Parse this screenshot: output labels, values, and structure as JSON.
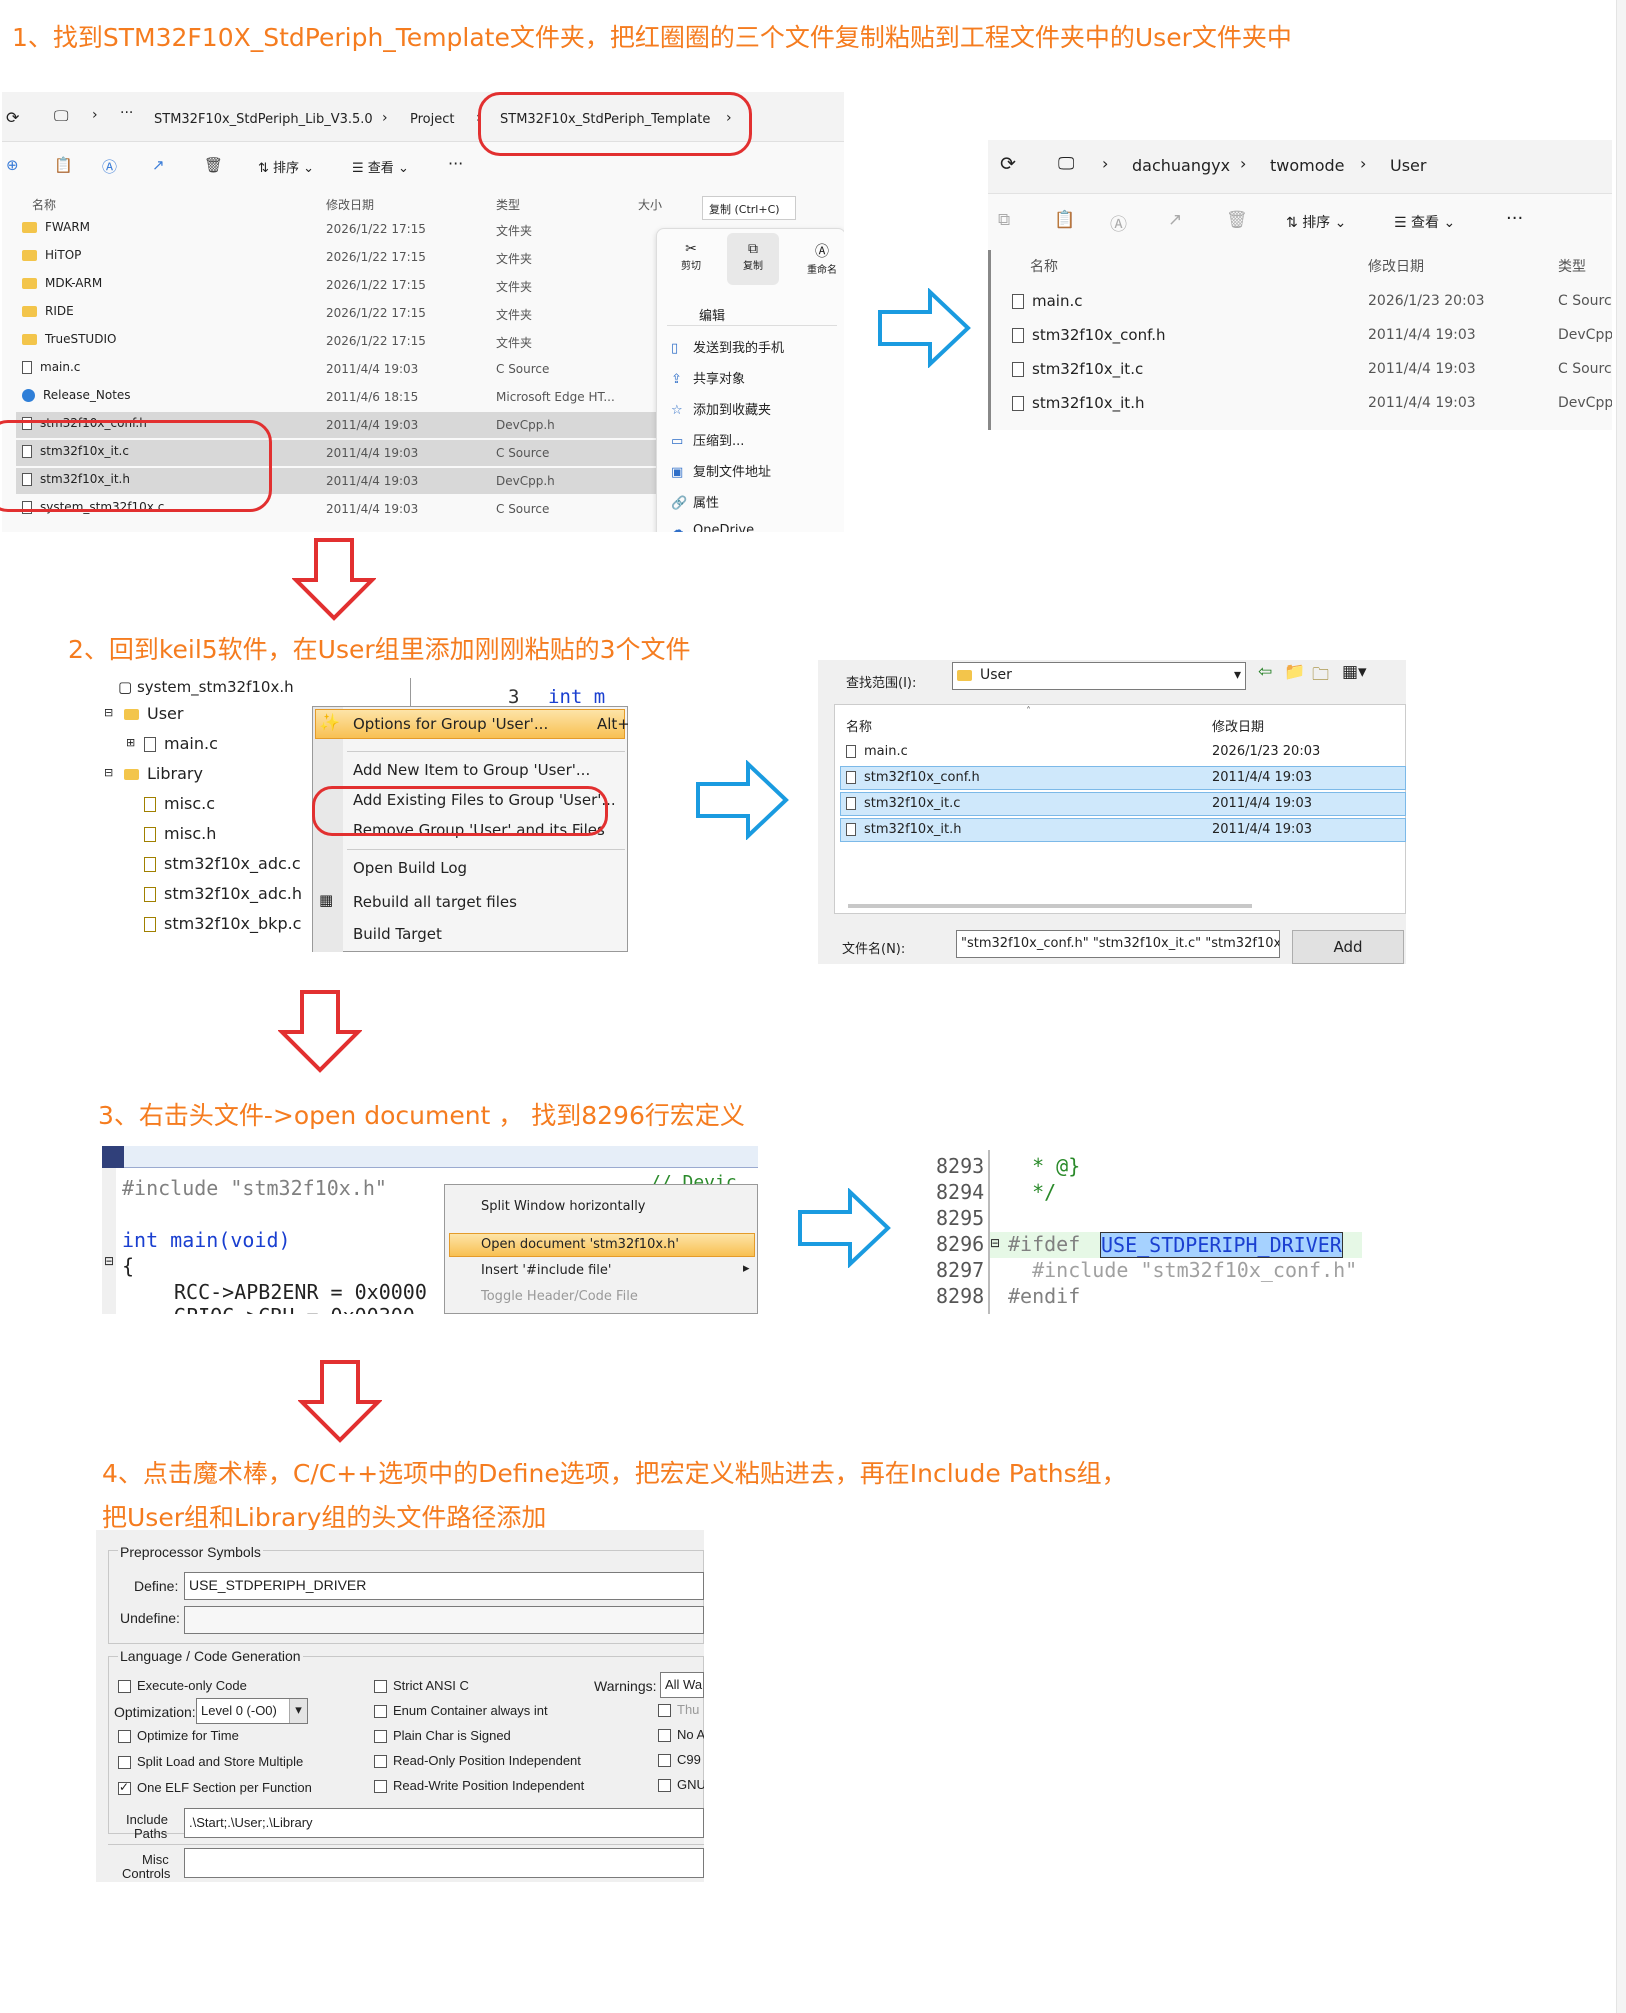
{
  "steps": {
    "s1": "1、找到STM32F10X_StdPeriph_Template文件夹，把红圈圈的三个文件复制粘贴到工程文件夹中的User文件夹中",
    "s2": "2、回到keil5软件，在User组里添加刚刚粘贴的3个文件",
    "s3": "3、右击头文件->open document ， 找到8296行宏定义",
    "s4a": "4、点击魔术棒，C/C++选项中的Define选项，把宏定义粘贴进去，再在Include Paths组，",
    "s4b": "把User组和Library组的头文件路径添加"
  },
  "explorer1": {
    "crumbs": [
      "STM32F10x_StdPeriph_Lib_V3.5.0",
      "Project",
      "STM32F10x_StdPeriph_Template"
    ],
    "sort": "排序",
    "view": "查看",
    "more": "···",
    "cols": [
      "名称",
      "修改日期",
      "类型",
      "大小"
    ],
    "rows": [
      {
        "name": "FWARM",
        "date": "2026/1/22 17:15",
        "type": "文件夹",
        "kind": "folder"
      },
      {
        "name": "HiTOP",
        "date": "2026/1/22 17:15",
        "type": "文件夹",
        "kind": "folder"
      },
      {
        "name": "MDK-ARM",
        "date": "2026/1/22 17:15",
        "type": "文件夹",
        "kind": "folder"
      },
      {
        "name": "RIDE",
        "date": "2026/1/22 17:15",
        "type": "文件夹",
        "kind": "folder"
      },
      {
        "name": "TrueSTUDIO",
        "date": "2026/1/22 17:15",
        "type": "文件夹",
        "kind": "folder"
      },
      {
        "name": "main.c",
        "date": "2011/4/4 19:03",
        "type": "C Source",
        "kind": "file"
      },
      {
        "name": "Release_Notes",
        "date": "2011/4/6 18:15",
        "type": "Microsoft Edge HT...",
        "kind": "edge"
      },
      {
        "name": "stm32f10x_conf.h",
        "date": "2011/4/4 19:03",
        "type": "DevCpp.h",
        "kind": "file"
      },
      {
        "name": "stm32f10x_it.c",
        "date": "2011/4/4 19:03",
        "type": "C Source",
        "kind": "file"
      },
      {
        "name": "stm32f10x_it.h",
        "date": "2011/4/4 19:03",
        "type": "DevCpp.h",
        "kind": "file"
      },
      {
        "name": "system_stm32f10x.c",
        "date": "2011/4/4 19:03",
        "type": "C Source",
        "kind": "file"
      }
    ],
    "tooltip": "复制 (Ctrl+C)",
    "ctx_icons": [
      "剪切",
      "复制",
      "重命名"
    ],
    "ctx": [
      "编辑",
      "发送到我的手机",
      "共享对象",
      "添加到收藏夹",
      "压缩到...",
      "复制文件地址",
      "属性",
      "OneDrive"
    ]
  },
  "explorer2": {
    "crumbs": [
      "dachuangyx",
      "twomode",
      "User"
    ],
    "sort": "排序",
    "view": "查看",
    "more": "···",
    "cols": [
      "名称",
      "修改日期",
      "类型"
    ],
    "rows": [
      {
        "name": "main.c",
        "date": "2026/1/23 20:03",
        "type": "C Sourc"
      },
      {
        "name": "stm32f10x_conf.h",
        "date": "2011/4/4 19:03",
        "type": "DevCpp"
      },
      {
        "name": "stm32f10x_it.c",
        "date": "2011/4/4 19:03",
        "type": "C Sourc"
      },
      {
        "name": "stm32f10x_it.h",
        "date": "2011/4/4 19:03",
        "type": "DevCpp"
      }
    ]
  },
  "keil_tree": {
    "top": "system_stm32f10x.h",
    "user": "User",
    "main": "main.c",
    "library": "Library",
    "libfiles": [
      "misc.c",
      "misc.h",
      "stm32f10x_adc.c",
      "stm32f10x_adc.h",
      "stm32f10x_bkp.c"
    ],
    "code_line": "3",
    "code_text": "int m",
    "menu": [
      {
        "label": "Options for Group 'User'...",
        "shortcut": "Alt+"
      },
      {
        "label": "Add New  Item to Group 'User'..."
      },
      {
        "label": "Add Existing Files to Group 'User'..."
      },
      {
        "label": "Remove Group 'User' and its Files"
      },
      {
        "label": "Open Build Log"
      },
      {
        "label": "Rebuild all target files"
      },
      {
        "label": "Build Target"
      }
    ]
  },
  "add_dialog": {
    "lookin_label": "查找范围(I):",
    "lookin_value": "User",
    "cols": [
      "名称",
      "修改日期"
    ],
    "rows": [
      {
        "name": "main.c",
        "date": "2026/1/23 20:03"
      },
      {
        "name": "stm32f10x_conf.h",
        "date": "2011/4/4 19:03"
      },
      {
        "name": "stm32f10x_it.c",
        "date": "2011/4/4 19:03"
      },
      {
        "name": "stm32f10x_it.h",
        "date": "2011/4/4 19:03"
      }
    ],
    "filename_label": "文件名(N):",
    "filename_value": "\"stm32f10x_conf.h\" \"stm32f10x_it.c\" \"stm32f10x_it.h\"",
    "add_btn": "Add"
  },
  "code1": {
    "include": "#include \"stm32f10x.h\"",
    "comment": "// Devic",
    "main": "int main(void)",
    "brace": "{",
    "rcc": "RCC->APB2ENR = 0x0000",
    "gpio": "GPIOC->CRH = 0x00300",
    "menu": [
      "Split Window horizontally",
      "Open document 'stm32f10x.h'",
      "Insert '#include file'",
      "Toggle Header/Code File"
    ]
  },
  "code2": {
    "lines": [
      {
        "n": "8293",
        "t": "  * @}"
      },
      {
        "n": "8294",
        "t": "  */"
      },
      {
        "n": "8295",
        "t": ""
      },
      {
        "n": "8296",
        "t": "#ifdef USE_STDPERIPH_DRIVER"
      },
      {
        "n": "8297",
        "t": "  #include \"stm32f10x_conf.h\""
      },
      {
        "n": "8298",
        "t": "#endif"
      }
    ],
    "ifdef": "#ifdef",
    "macro": "USE_STDPERIPH_DRIVER"
  },
  "options": {
    "pre_title": "Preprocessor Symbols",
    "define_label": "Define:",
    "define_value": "USE_STDPERIPH_DRIVER",
    "undefine_label": "Undefine:",
    "lang_title": "Language / Code Generation",
    "c1": [
      "Execute-only Code",
      "Optimize for Time",
      "Split Load and Store Multiple",
      "One ELF Section per Function"
    ],
    "c1_checked": [
      false,
      false,
      false,
      true
    ],
    "opt_label": "Optimization:",
    "opt_value": "Level 0 (-O0)",
    "c2": [
      "Strict ANSI C",
      "Enum Container always int",
      "Plain Char is Signed",
      "Read-Only Position Independent",
      "Read-Write Position Independent"
    ],
    "warn_label": "Warnings:",
    "warn_value": "All War",
    "c3": [
      "Thu",
      "No A",
      "C99",
      "GNU"
    ],
    "include_label1": "Include",
    "include_label2": "Paths",
    "include_value": ".\\Start;.\\User;.\\Library",
    "misc_label1": "Misc",
    "misc_label2": "Controls"
  },
  "colors": {
    "step": "#f57c1f",
    "circle": "#e23030",
    "arrow_blue": "#1a9be0",
    "arrow_red": "#e23030"
  }
}
